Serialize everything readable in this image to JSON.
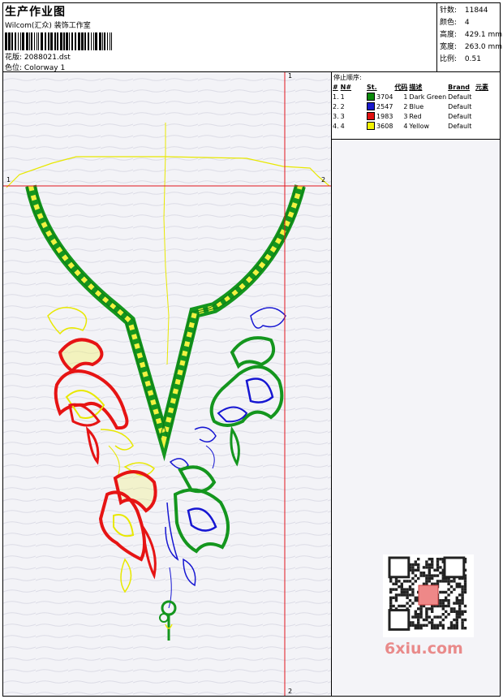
{
  "header": {
    "title": "生产作业图",
    "studio": "Wilcom(汇众) 装饰工作室",
    "design_label": "花版:",
    "design_value": "2088021.dst",
    "colorway_label": "色位:",
    "colorway_value": "Colorway 1"
  },
  "stats": {
    "stitches_label": "针数:",
    "stitches_value": "11844",
    "colors_label": "颜色:",
    "colors_value": "4",
    "height_label": "高度:",
    "height_value": "429.1 mm",
    "width_label": "宽度:",
    "width_value": "263.0 mm",
    "ratio_label": "比例:",
    "ratio_value": "0.51"
  },
  "stop_sequence": {
    "title": "停止顺序:",
    "columns": [
      "#",
      "N#",
      "St.",
      "代码",
      "描述",
      "Brand",
      "元素"
    ],
    "rows": [
      {
        "idx": "1.",
        "n": "1",
        "swatch": "#0a8a0a",
        "st": "3704",
        "code": "1",
        "desc": "Dark Green",
        "brand": "Default"
      },
      {
        "idx": "2.",
        "n": "2",
        "swatch": "#1a1acc",
        "st": "2547",
        "code": "2",
        "desc": "Blue",
        "brand": "Default"
      },
      {
        "idx": "3.",
        "n": "3",
        "swatch": "#e01010",
        "st": "1983",
        "code": "3",
        "desc": "Red",
        "brand": "Default"
      },
      {
        "idx": "4.",
        "n": "4",
        "swatch": "#f2f200",
        "st": "3608",
        "code": "4",
        "desc": "Yellow",
        "brand": "Default"
      }
    ]
  },
  "markers": {
    "left_1": "1",
    "right_2": "2",
    "top_1": "1",
    "bottom_2": "2"
  },
  "colors": {
    "green": "#14961e",
    "blue": "#1616d2",
    "red": "#e61414",
    "yellow": "#f0f000",
    "guide_red": "#e0141e"
  },
  "watermark": {
    "text": "6xiu.com",
    "seal_text": "设计"
  }
}
